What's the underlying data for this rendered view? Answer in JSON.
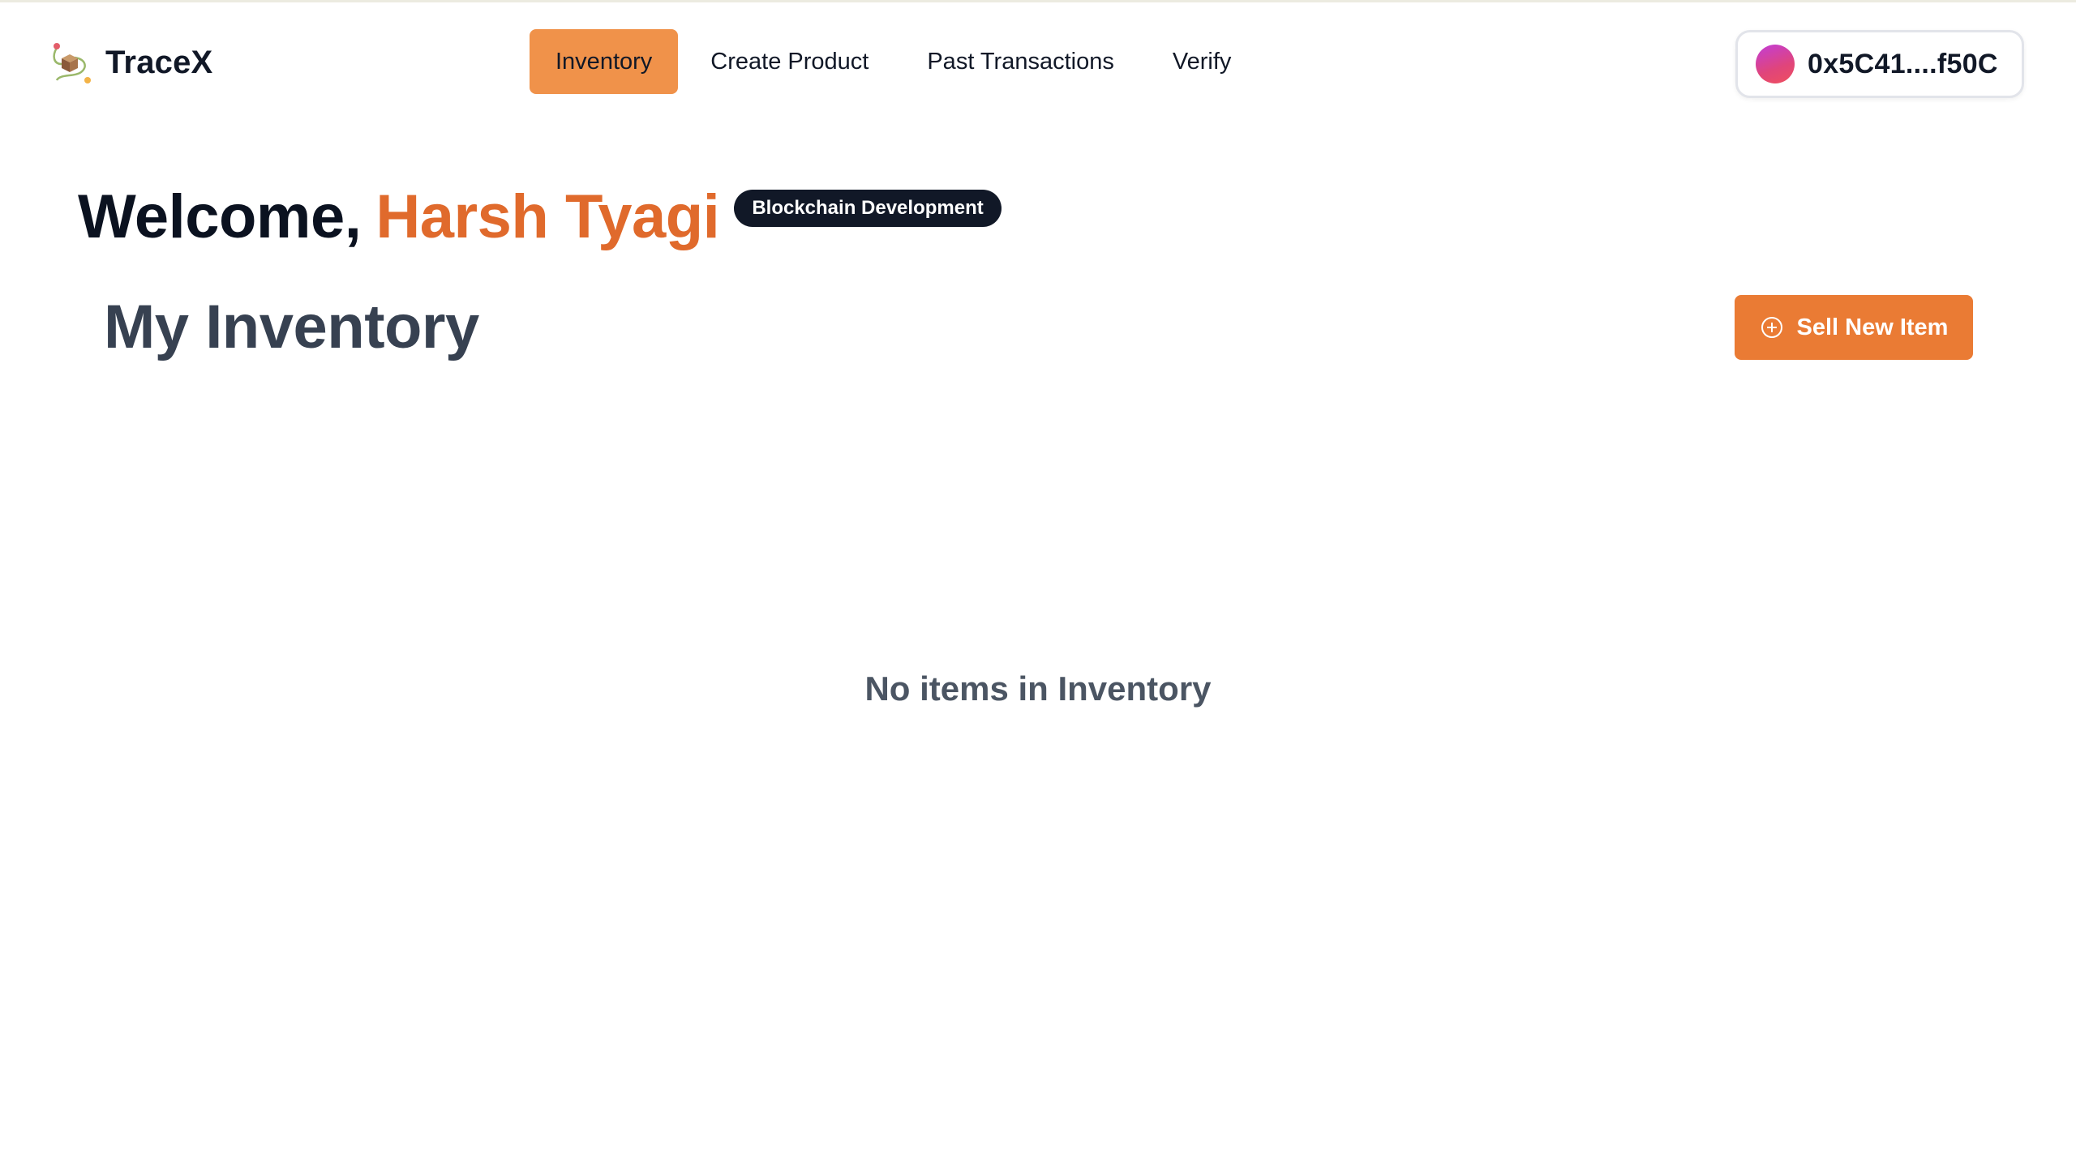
{
  "brand": {
    "name": "TraceX",
    "logo_icon": "tracex-logo-icon"
  },
  "nav": {
    "items": [
      {
        "label": "Inventory",
        "active": true
      },
      {
        "label": "Create Product",
        "active": false
      },
      {
        "label": "Past Transactions",
        "active": false
      },
      {
        "label": "Verify",
        "active": false
      }
    ]
  },
  "wallet": {
    "address": "0x5C41....f50C",
    "avatar_icon": "wallet-avatar-icon"
  },
  "welcome": {
    "prefix": "Welcome,",
    "name": "Harsh Tyagi",
    "role_badge": "Blockchain Development"
  },
  "inventory": {
    "title": "My Inventory",
    "sell_button_label": "Sell New Item",
    "sell_button_icon": "plus-circle-icon",
    "empty_message": "No items in Inventory"
  },
  "colors": {
    "accent": "#ea7b34",
    "nav_active": "#f0924a",
    "name_highlight": "#e06a2c",
    "badge_bg": "#111827"
  }
}
